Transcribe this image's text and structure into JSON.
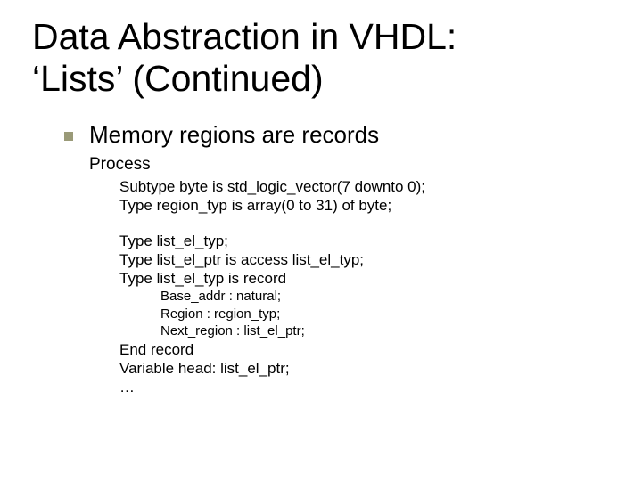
{
  "title_line1": "Data Abstraction in VHDL:",
  "title_line2": "‘Lists’ (Continued)",
  "bullet": "Memory regions are records",
  "sub1": "Process",
  "code1a": "Subtype byte is std_logic_vector(7 downto 0);",
  "code1b": "Type region_typ is array(0 to 31) of byte;",
  "code2a": "Type list_el_typ;",
  "code2b": "Type list_el_ptr is access list_el_typ;",
  "code2c": "Type list_el_typ is record",
  "code3a": "Base_addr : natural;",
  "code3b": "Region : region_typ;",
  "code3c": "Next_region : list_el_ptr;",
  "code4a": "End record",
  "code4b": "Variable head: list_el_ptr;",
  "code4c": "…"
}
